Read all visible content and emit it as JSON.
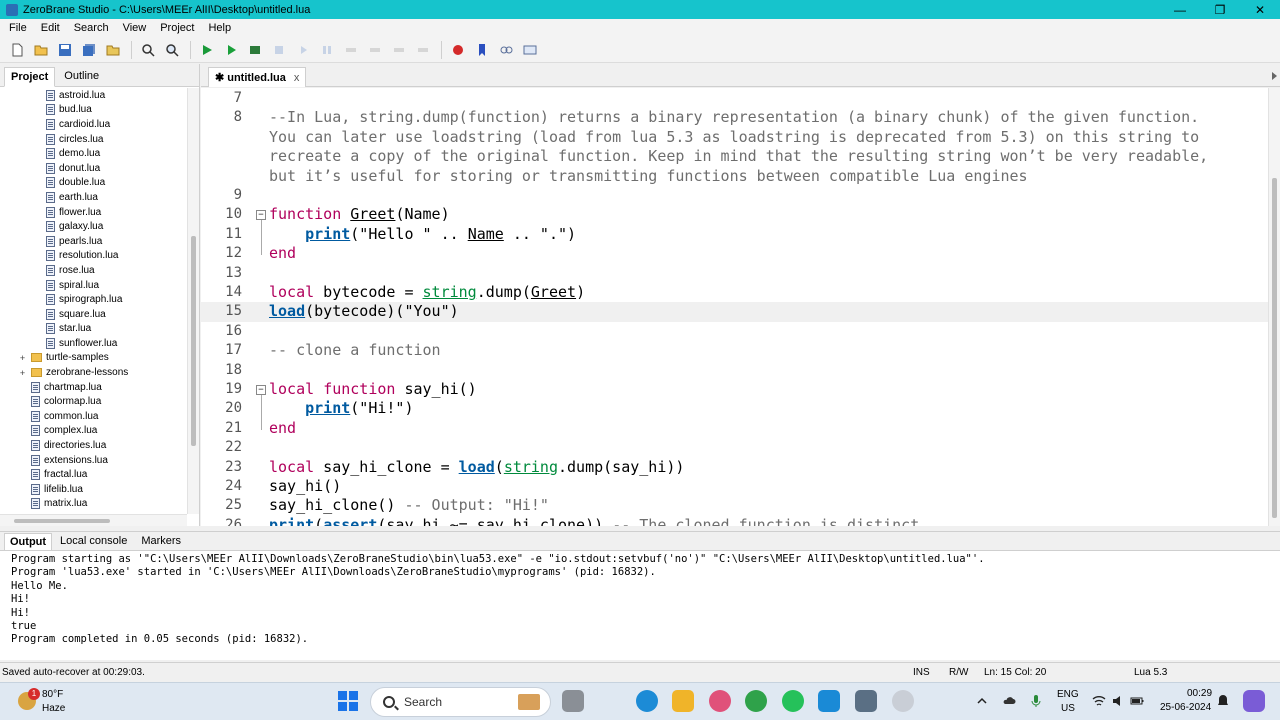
{
  "window": {
    "title": "ZeroBrane Studio - C:\\Users\\MEEr AlII\\Desktop\\untitled.lua",
    "minimize": "—",
    "maximize": "❐",
    "close": "✕"
  },
  "menu": [
    "File",
    "Edit",
    "Search",
    "View",
    "Project",
    "Help"
  ],
  "left_panel": {
    "tabs": [
      "Project",
      "Outline"
    ],
    "active_tab": "Project",
    "tree": [
      {
        "label": "astroid.lua",
        "type": "file",
        "indent": 2
      },
      {
        "label": "bud.lua",
        "type": "file",
        "indent": 2
      },
      {
        "label": "cardioid.lua",
        "type": "file",
        "indent": 2
      },
      {
        "label": "circles.lua",
        "type": "file",
        "indent": 2
      },
      {
        "label": "demo.lua",
        "type": "file",
        "indent": 2
      },
      {
        "label": "donut.lua",
        "type": "file",
        "indent": 2
      },
      {
        "label": "double.lua",
        "type": "file",
        "indent": 2
      },
      {
        "label": "earth.lua",
        "type": "file",
        "indent": 2
      },
      {
        "label": "flower.lua",
        "type": "file",
        "indent": 2
      },
      {
        "label": "galaxy.lua",
        "type": "file",
        "indent": 2
      },
      {
        "label": "pearls.lua",
        "type": "file",
        "indent": 2
      },
      {
        "label": "resolution.lua",
        "type": "file",
        "indent": 2
      },
      {
        "label": "rose.lua",
        "type": "file",
        "indent": 2
      },
      {
        "label": "spiral.lua",
        "type": "file",
        "indent": 2
      },
      {
        "label": "spirograph.lua",
        "type": "file",
        "indent": 2
      },
      {
        "label": "square.lua",
        "type": "file",
        "indent": 2
      },
      {
        "label": "star.lua",
        "type": "file",
        "indent": 2
      },
      {
        "label": "sunflower.lua",
        "type": "file",
        "indent": 2
      },
      {
        "label": "turtle-samples",
        "type": "folder",
        "indent": 1
      },
      {
        "label": "zerobrane-lessons",
        "type": "folder",
        "indent": 1
      },
      {
        "label": "chartmap.lua",
        "type": "file",
        "indent": 1
      },
      {
        "label": "colormap.lua",
        "type": "file",
        "indent": 1
      },
      {
        "label": "common.lua",
        "type": "file",
        "indent": 1
      },
      {
        "label": "complex.lua",
        "type": "file",
        "indent": 1
      },
      {
        "label": "directories.lua",
        "type": "file",
        "indent": 1
      },
      {
        "label": "extensions.lua",
        "type": "file",
        "indent": 1
      },
      {
        "label": "fractal.lua",
        "type": "file",
        "indent": 1
      },
      {
        "label": "lifelib.lua",
        "type": "file",
        "indent": 1
      },
      {
        "label": "matrix.lua",
        "type": "file",
        "indent": 1
      }
    ]
  },
  "editor": {
    "tab_label": "untitled.lua",
    "tab_modified_marker": "✱",
    "tab_close": "x",
    "lines": [
      {
        "n": "7",
        "html": ""
      },
      {
        "n": "8",
        "html": "<span class='cm'>--In Lua, string.dump(function) returns a binary representation (a binary chunk) of the given function.</span>"
      },
      {
        "n": "",
        "html": "<span class='cm'>You can later use loadstring (load from lua 5.3 as loadstring is deprecated from 5.3) on this string to</span>"
      },
      {
        "n": "",
        "html": "<span class='cm'>recreate a copy of the original function. Keep in mind that the resulting string won’t be very readable,</span>"
      },
      {
        "n": "",
        "html": "<span class='cm'>but it’s useful for storing or transmitting functions between compatible Lua engines</span>"
      },
      {
        "n": "9",
        "html": ""
      },
      {
        "n": "10",
        "html": "<span class='kw'>function</span> <span class='ul'>Greet</span>(Name)",
        "fold": "⊟"
      },
      {
        "n": "11",
        "html": "    <span class='fn'>print</span>(\"Hello \" .. <span class='ul'>Name</span> .. \".\")"
      },
      {
        "n": "12",
        "html": "<span class='kw'>end</span>"
      },
      {
        "n": "13",
        "html": ""
      },
      {
        "n": "14",
        "html": "<span class='kw'>local</span> bytecode = <span class='lib'>string</span>.dump(<span class='ul'>Greet</span>)"
      },
      {
        "n": "15",
        "html": "<span class='fn'>load</span>(bytecode)(\"You\")",
        "current": true
      },
      {
        "n": "16",
        "html": ""
      },
      {
        "n": "17",
        "html": "<span class='cm'>-- clone a function</span>"
      },
      {
        "n": "18",
        "html": ""
      },
      {
        "n": "19",
        "html": "<span class='kw'>local</span> <span class='kw'>function</span> say_hi()",
        "fold": "⊟"
      },
      {
        "n": "20",
        "html": "    <span class='fn'>print</span>(\"Hi!\")"
      },
      {
        "n": "21",
        "html": "<span class='kw'>end</span>"
      },
      {
        "n": "22",
        "html": ""
      },
      {
        "n": "23",
        "html": "<span class='kw'>local</span> say_hi_clone = <span class='fn'>load</span>(<span class='lib'>string</span>.dump(say_hi))"
      },
      {
        "n": "24",
        "html": "say_hi()"
      },
      {
        "n": "25",
        "html": "say_hi_clone() <span class='cm'>-- Output: \"Hi!\"</span>"
      },
      {
        "n": "26",
        "html": "<span class='fn'>print</span>(<span class='fn'>assert</span>(say_hi ~= say_hi_clone)) <span class='cm'>-- The cloned function is distinct</span>"
      }
    ]
  },
  "bottom_panel": {
    "tabs": [
      "Output",
      "Local console",
      "Markers"
    ],
    "active_tab": "Output",
    "output_lines": [
      "Program starting as '\"C:\\Users\\MEEr AlII\\Downloads\\ZeroBraneStudio\\bin\\lua53.exe\" -e \"io.stdout:setvbuf('no')\" \"C:\\Users\\MEEr AlII\\Desktop\\untitled.lua\"'.",
      "Program 'lua53.exe' started in 'C:\\Users\\MEEr AlII\\Downloads\\ZeroBraneStudio\\myprograms' (pid: 16832).",
      "Hello Me.",
      "Hi!",
      "Hi!",
      "true",
      "Program completed in 0.05 seconds (pid: 16832)."
    ]
  },
  "status": {
    "message": "Saved auto-recover at 00:29:03.",
    "ins": "INS",
    "rw": "R/W",
    "position": "Ln: 15 Col: 20",
    "language": "Lua 5.3"
  },
  "taskbar": {
    "weather_badge": "1",
    "temperature": "80°F",
    "condition": "Haze",
    "search_label": "Search",
    "language_top": "ENG",
    "language_bottom": "US",
    "time": "00:29",
    "date": "25-06-2024"
  }
}
